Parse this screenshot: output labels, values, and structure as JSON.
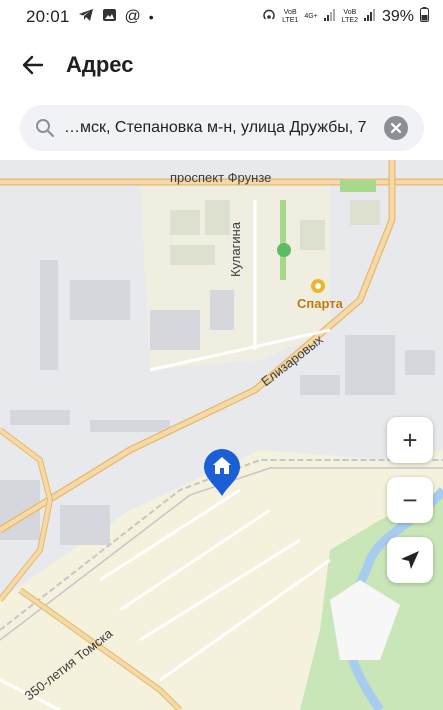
{
  "status_bar": {
    "time": "20:01",
    "net1_top": "VoB",
    "net1_bottom": "LTE1",
    "net_type": "4G+",
    "net2_top": "VoB",
    "net2_bottom": "LTE2",
    "battery": "39%"
  },
  "header": {
    "title": "Адрес",
    "back_icon": "arrow-left-icon"
  },
  "search": {
    "value": "…мск, Степановка м-н, улица Дружбы, 7"
  },
  "map": {
    "labels": {
      "prospect": "проспект Фрунзе",
      "kulagina": "Кулагина",
      "sparta": "Спарта",
      "elizarovykh": "Елизаровых",
      "tomsk350": "350-летия Томска"
    },
    "controls": {
      "zoom_in": "+",
      "zoom_out": "−"
    }
  },
  "colors": {
    "accent": "#1a5fd6",
    "road": "#f5d9a8",
    "road_edge": "#e6b86a",
    "residential": "#f4f1dc",
    "forest": "#c8e6b8",
    "river": "#a6cdef"
  }
}
